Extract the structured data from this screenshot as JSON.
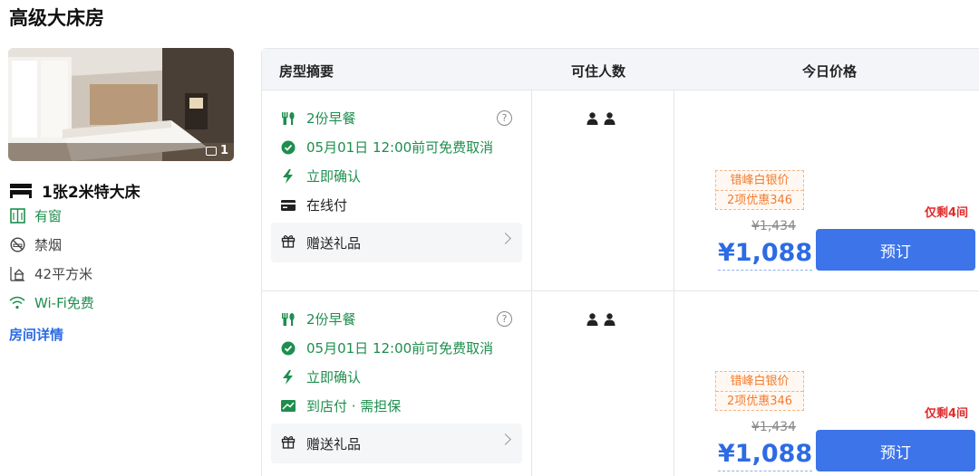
{
  "page": {
    "room_title": "高级大床房"
  },
  "room": {
    "photo_count": "1",
    "bed": "1张2米特大床",
    "features": [
      {
        "label": "有窗",
        "icon": "window-icon",
        "color": "#1e8e4e"
      },
      {
        "label": "禁烟",
        "icon": "no-smoking-icon",
        "color": "#444444"
      },
      {
        "label": "42平方米",
        "icon": "area-icon",
        "color": "#444444"
      },
      {
        "label": "Wi-Fi免费",
        "icon": "wifi-icon",
        "color": "#1e8e4e"
      }
    ],
    "details_link": "房间详情"
  },
  "table": {
    "headers": {
      "summary": "房型摘要",
      "occupancy": "可住人数",
      "price": "今日价格"
    },
    "rows": [
      {
        "breakfast": "2份早餐",
        "cancel": "05月01日 12:00前可免费取消",
        "confirm": "立即确认",
        "payment": "在线付",
        "payment_color": "#222222",
        "gift": "赠送礼品",
        "occupancy_icons": [
          "person-icon",
          "person-icon"
        ],
        "promo_tier": "错峰白银价",
        "promo_discount": "2项优惠346",
        "original_price": "¥1,434",
        "price": "¥1,088",
        "remaining": "仅剩4间",
        "book": "预订"
      },
      {
        "breakfast": "2份早餐",
        "cancel": "05月01日 12:00前可免费取消",
        "confirm": "立即确认",
        "payment": "到店付 · 需担保",
        "payment_color": "#1e8e4e",
        "gift": "赠送礼品",
        "occupancy_icons": [
          "person-icon",
          "person-icon"
        ],
        "promo_tier": "错峰白银价",
        "promo_discount": "2项优惠346",
        "original_price": "¥1,434",
        "price": "¥1,088",
        "remaining": "仅剩4间",
        "book": "预订"
      }
    ]
  },
  "colors": {
    "accent": "#3d74ea",
    "price": "#2d6be4",
    "green": "#1e8e4e",
    "promo": "#f27c2e",
    "alert": "#e02b2b"
  }
}
